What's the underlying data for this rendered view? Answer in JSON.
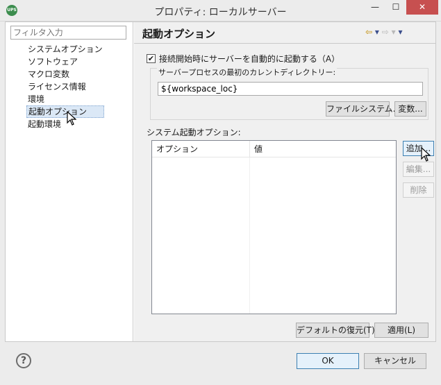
{
  "window": {
    "title": "プロパティ: ローカルサーバー",
    "app_icon_text": "UPS",
    "minimize_glyph": "—",
    "maximize_glyph": "☐",
    "close_glyph": "✕"
  },
  "sidebar": {
    "filter_placeholder": "フィルタ入力",
    "items": [
      {
        "label": "システムオプション",
        "selected": false
      },
      {
        "label": "ソフトウェア",
        "selected": false
      },
      {
        "label": "マクロ変数",
        "selected": false
      },
      {
        "label": "ライセンス情報",
        "selected": false
      },
      {
        "label": "環境",
        "selected": false
      },
      {
        "label": "起動オプション",
        "selected": true
      },
      {
        "label": "起動環境",
        "selected": false
      }
    ]
  },
  "page": {
    "title": "起動オプション",
    "nav_back_glyph": "⇦",
    "nav_forward_glyph": "⇨",
    "dropdown_glyph": "▾",
    "auto_start_checkbox": {
      "label": "接続開始時にサーバーを自動的に起動する（A）",
      "checked": true,
      "glyph": "✔"
    },
    "dir_group": {
      "label": "サーバープロセスの最初のカレントディレクトリー:",
      "value": "${workspace_loc}",
      "filesystem_button": "ファイルシステム...",
      "variables_button": "変数..."
    },
    "system_options": {
      "label": "システム起動オプション:",
      "columns": [
        "オプション",
        "値"
      ],
      "rows": [],
      "add_button": "追加...",
      "edit_button": "編集...",
      "delete_button": "削除"
    },
    "restore_defaults_button": "デフォルトの復元(T)",
    "apply_button": "適用(L)"
  },
  "footer": {
    "help_glyph": "?",
    "ok_button": "OK",
    "cancel_button": "キャンセル"
  },
  "colors": {
    "selection": "#dbe8f6",
    "close_button": "#c75050",
    "focus_border": "#3c7fb1"
  }
}
